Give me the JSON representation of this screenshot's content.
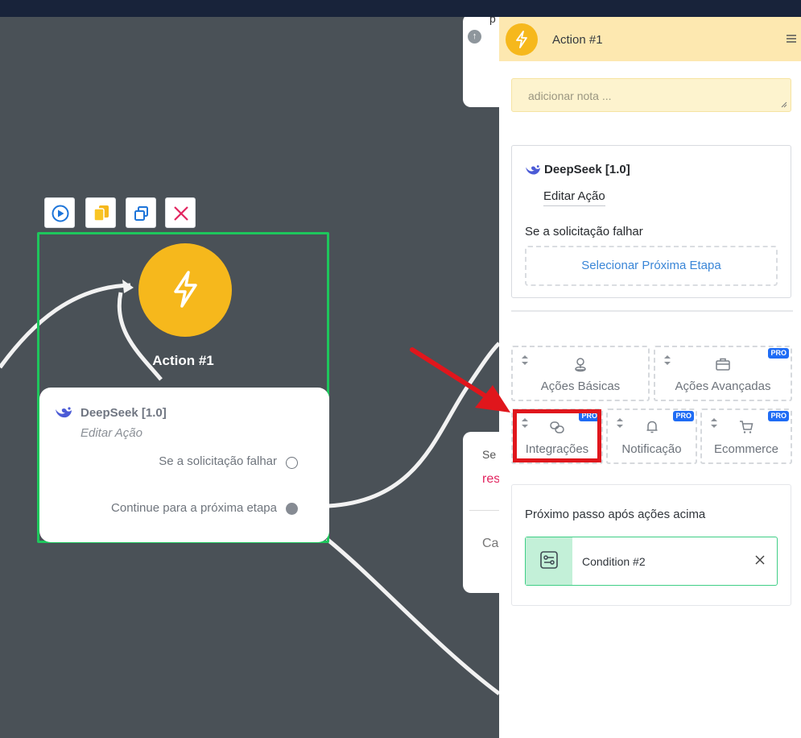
{
  "canvas": {
    "bg_card_top_text": "p",
    "bg_card_mid": {
      "se": "Se",
      "res": "res",
      "ca": "Ca"
    },
    "node": {
      "title": "Action #1",
      "app_name": "DeepSeek [1.0]",
      "edit_label": "Editar Ação",
      "fail_label": "Se a solicitação falhar",
      "continue_label": "Continue para a próxima etapa"
    }
  },
  "panel": {
    "title": "Action #1",
    "note_placeholder": "adicionar nota ...",
    "app_card": {
      "name": "DeepSeek [1.0]",
      "edit_label": "Editar Ação",
      "fail_label": "Se a solicitação falhar",
      "next_step_button": "Selecionar Próxima Etapa"
    },
    "tiles": [
      {
        "label": "Ações Básicas",
        "icon": "user-pin-icon",
        "pro": false
      },
      {
        "label": "Ações Avançadas",
        "icon": "briefcase-icon",
        "pro": true,
        "badge": "PRO"
      },
      {
        "label": "Integrações",
        "icon": "link-chain-icon",
        "pro": true,
        "badge": "PRO"
      },
      {
        "label": "Notificação",
        "icon": "bell-icon",
        "pro": true,
        "badge": "PRO"
      },
      {
        "label": "Ecommerce",
        "icon": "cart-icon",
        "pro": true,
        "badge": "PRO"
      }
    ],
    "after_actions": {
      "title": "Próximo passo após ações acima",
      "next_condition": "Condition #2"
    }
  },
  "colors": {
    "canvas_bg": "#4a5157",
    "accent_yellow": "#f6b81c",
    "node_border_green": "#1ec65c",
    "link_blue": "#3a86d7",
    "pro_badge": "#1f6cf5",
    "highlight_red": "#e0161c"
  }
}
